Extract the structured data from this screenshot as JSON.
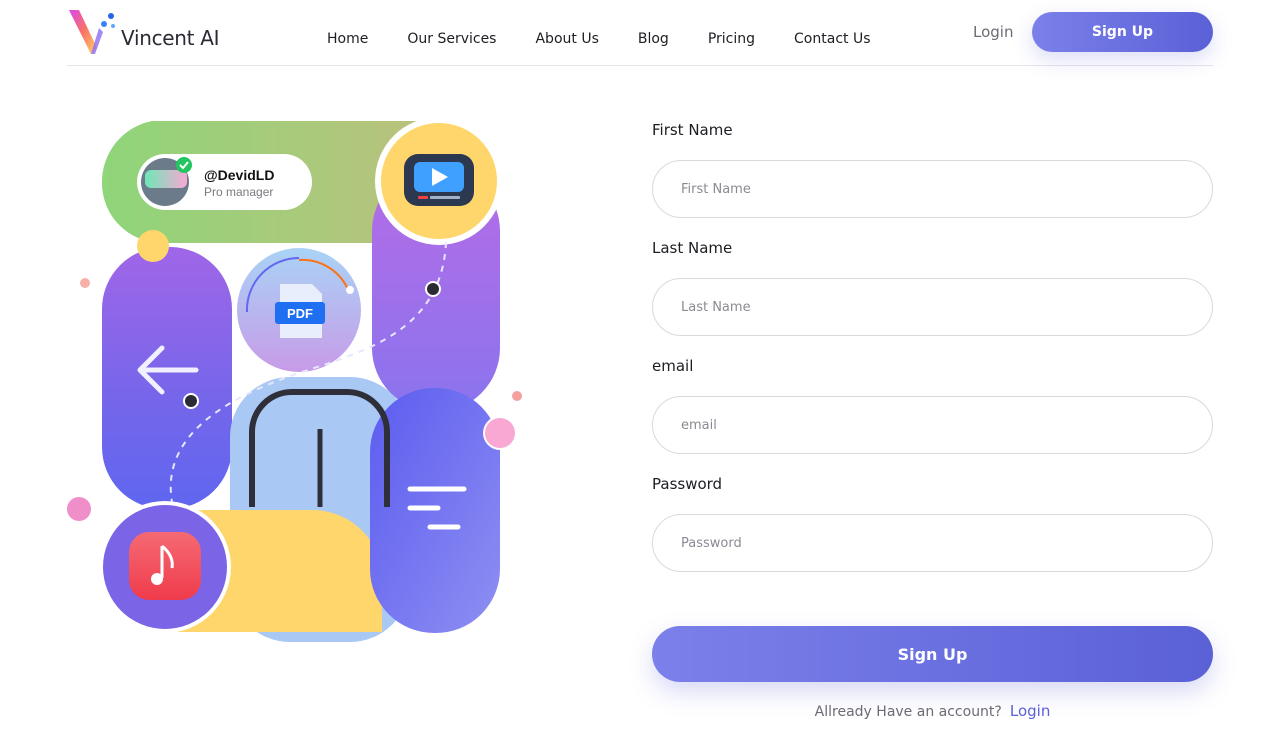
{
  "brand": {
    "name": "Vincent AI"
  },
  "nav": [
    {
      "label": "Home"
    },
    {
      "label": "Our Services"
    },
    {
      "label": "About Us"
    },
    {
      "label": "Blog"
    },
    {
      "label": "Pricing"
    },
    {
      "label": "Contact Us"
    }
  ],
  "header": {
    "login_label": "Login",
    "signup_label": "Sign Up"
  },
  "profile_card": {
    "handle": "@DevidLD",
    "role": "Pro manager"
  },
  "illustration": {
    "pdf_label": "PDF"
  },
  "form": {
    "first_name": {
      "label": "First Name",
      "placeholder": "First Name"
    },
    "last_name": {
      "label": "Last Name",
      "placeholder": "Last Name"
    },
    "email": {
      "label": "email",
      "placeholder": "email"
    },
    "password": {
      "label": "Password",
      "placeholder": "Password"
    },
    "submit_label": "Sign Up",
    "footer_prompt": "Allready Have an account?",
    "footer_link": "Login"
  },
  "colors": {
    "accent": "#6168dc",
    "accent_light": "#7b80ea",
    "yellow": "#ffd66b",
    "green": "#8fd57a"
  },
  "icons": [
    "logo-v-icon",
    "video-player-icon",
    "pdf-file-icon",
    "arrow-left-icon",
    "music-note-icon",
    "menu-lines-icon",
    "verified-check-icon"
  ]
}
